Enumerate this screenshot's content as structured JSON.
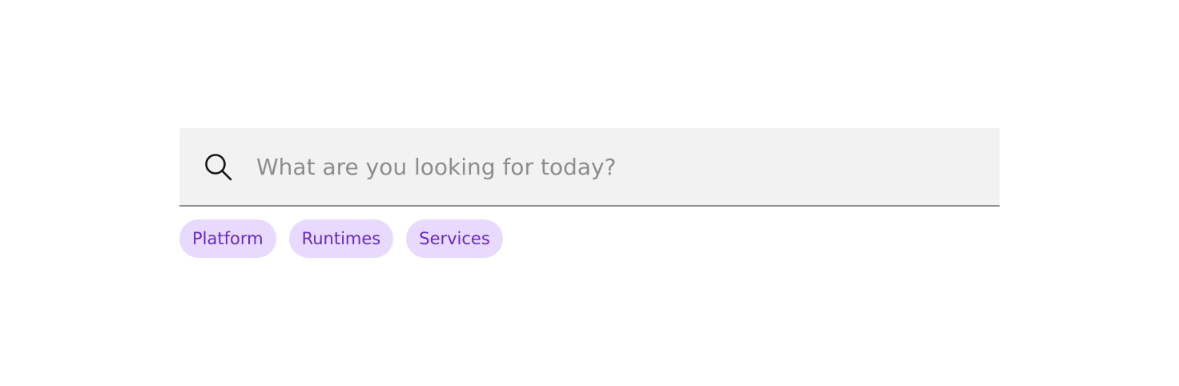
{
  "search": {
    "placeholder": "What are you looking for today?",
    "value": "",
    "icon": "search-icon"
  },
  "tags": [
    {
      "label": "Platform"
    },
    {
      "label": "Runtimes"
    },
    {
      "label": "Services"
    }
  ],
  "colors": {
    "field_background": "#f2f2f2",
    "field_underline": "#8d8d8d",
    "placeholder_text": "#8d8d8d",
    "tag_background": "#e8daff",
    "tag_text": "#6929c4"
  }
}
